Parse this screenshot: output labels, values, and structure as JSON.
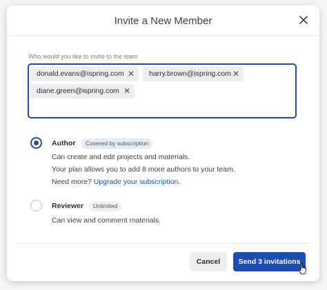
{
  "dialog": {
    "title": "Invite a New Member",
    "field_label": "Who would you like to invite to the team",
    "emails": [
      "donald.evans@ispring.com",
      "harry.brown@ispring.com",
      "diane.green@ispring.com"
    ],
    "roles": [
      {
        "name": "Author",
        "badge": "Covered by subscription",
        "selected": true,
        "description": "Can create and edit projects and materials.",
        "plan_note": "Your plan allows you to add 8 more authors to your team.",
        "need_more": "Need more?",
        "upgrade_link": "Upgrade your subscription",
        "period": "."
      },
      {
        "name": "Reviewer",
        "badge": "Unlimited",
        "selected": false,
        "description": "Can view and comment materials."
      }
    ],
    "cancel_label": "Cancel",
    "send_label": "Send 3 invitations"
  },
  "icons": {
    "close": "close-icon",
    "chip_remove": "close-icon",
    "cursor": "hand-pointer-icon"
  },
  "colors": {
    "accent": "#1c4db3",
    "badge_blue": "#e4ebf6",
    "chip_bg": "#eceef0"
  }
}
